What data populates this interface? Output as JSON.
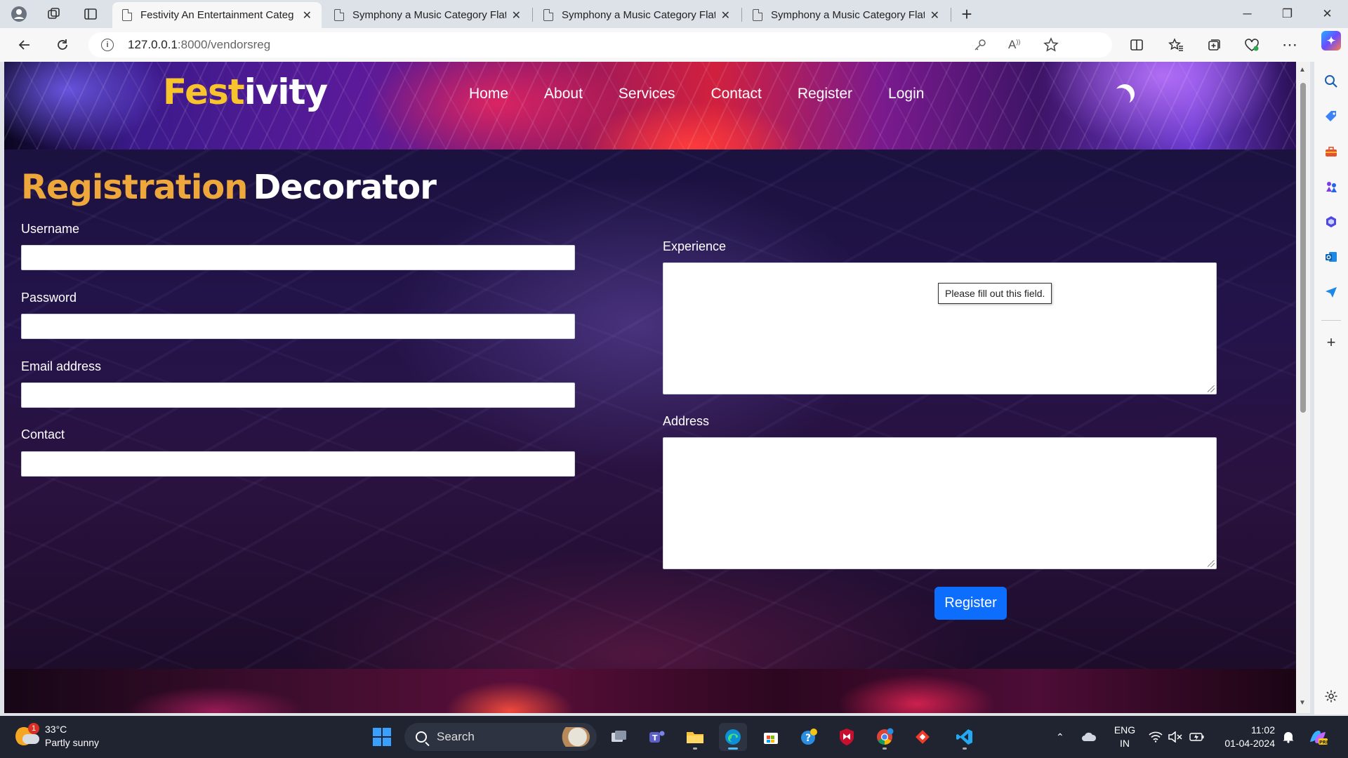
{
  "browser": {
    "tabs": [
      {
        "title": "Festivity An Entertainment Categ",
        "active": true
      },
      {
        "title": "Symphony a Music Category Flat",
        "active": false
      },
      {
        "title": "Symphony a Music Category Flat",
        "active": false
      },
      {
        "title": "Symphony a Music Category Flat",
        "active": false
      }
    ],
    "new_tab_symbol": "+",
    "url_host": "127.0.0.1",
    "url_rest": ":8000/vendorsreg"
  },
  "site": {
    "logo_part1": "Fest",
    "logo_part2": "ivity",
    "nav": [
      "Home",
      "About",
      "Services",
      "Contact",
      "Register",
      "Login"
    ],
    "theme_toggle_icon": "moon-icon"
  },
  "page": {
    "title_highlight": "Registration",
    "title_rest": "Decorator",
    "fields": {
      "username": {
        "label": "Username",
        "value": ""
      },
      "password": {
        "label": "Password",
        "value": ""
      },
      "email": {
        "label": "Email address",
        "value": ""
      },
      "contact": {
        "label": "Contact",
        "value": ""
      },
      "experience": {
        "label": "Experience",
        "value": ""
      },
      "address": {
        "label": "Address",
        "value": ""
      }
    },
    "validation_tooltip": "Please fill out this field.",
    "submit_label": "Register"
  },
  "colors": {
    "logo_yellow": "#f7c52b",
    "title_orange": "#eda73a",
    "button_blue": "#0d6efd"
  },
  "taskbar": {
    "weather_temp": "33°C",
    "weather_desc": "Partly sunny",
    "weather_badge": "1",
    "search_placeholder": "Search",
    "lang_line1": "ENG",
    "lang_line2": "IN",
    "time": "11:02",
    "date": "01-04-2024"
  }
}
